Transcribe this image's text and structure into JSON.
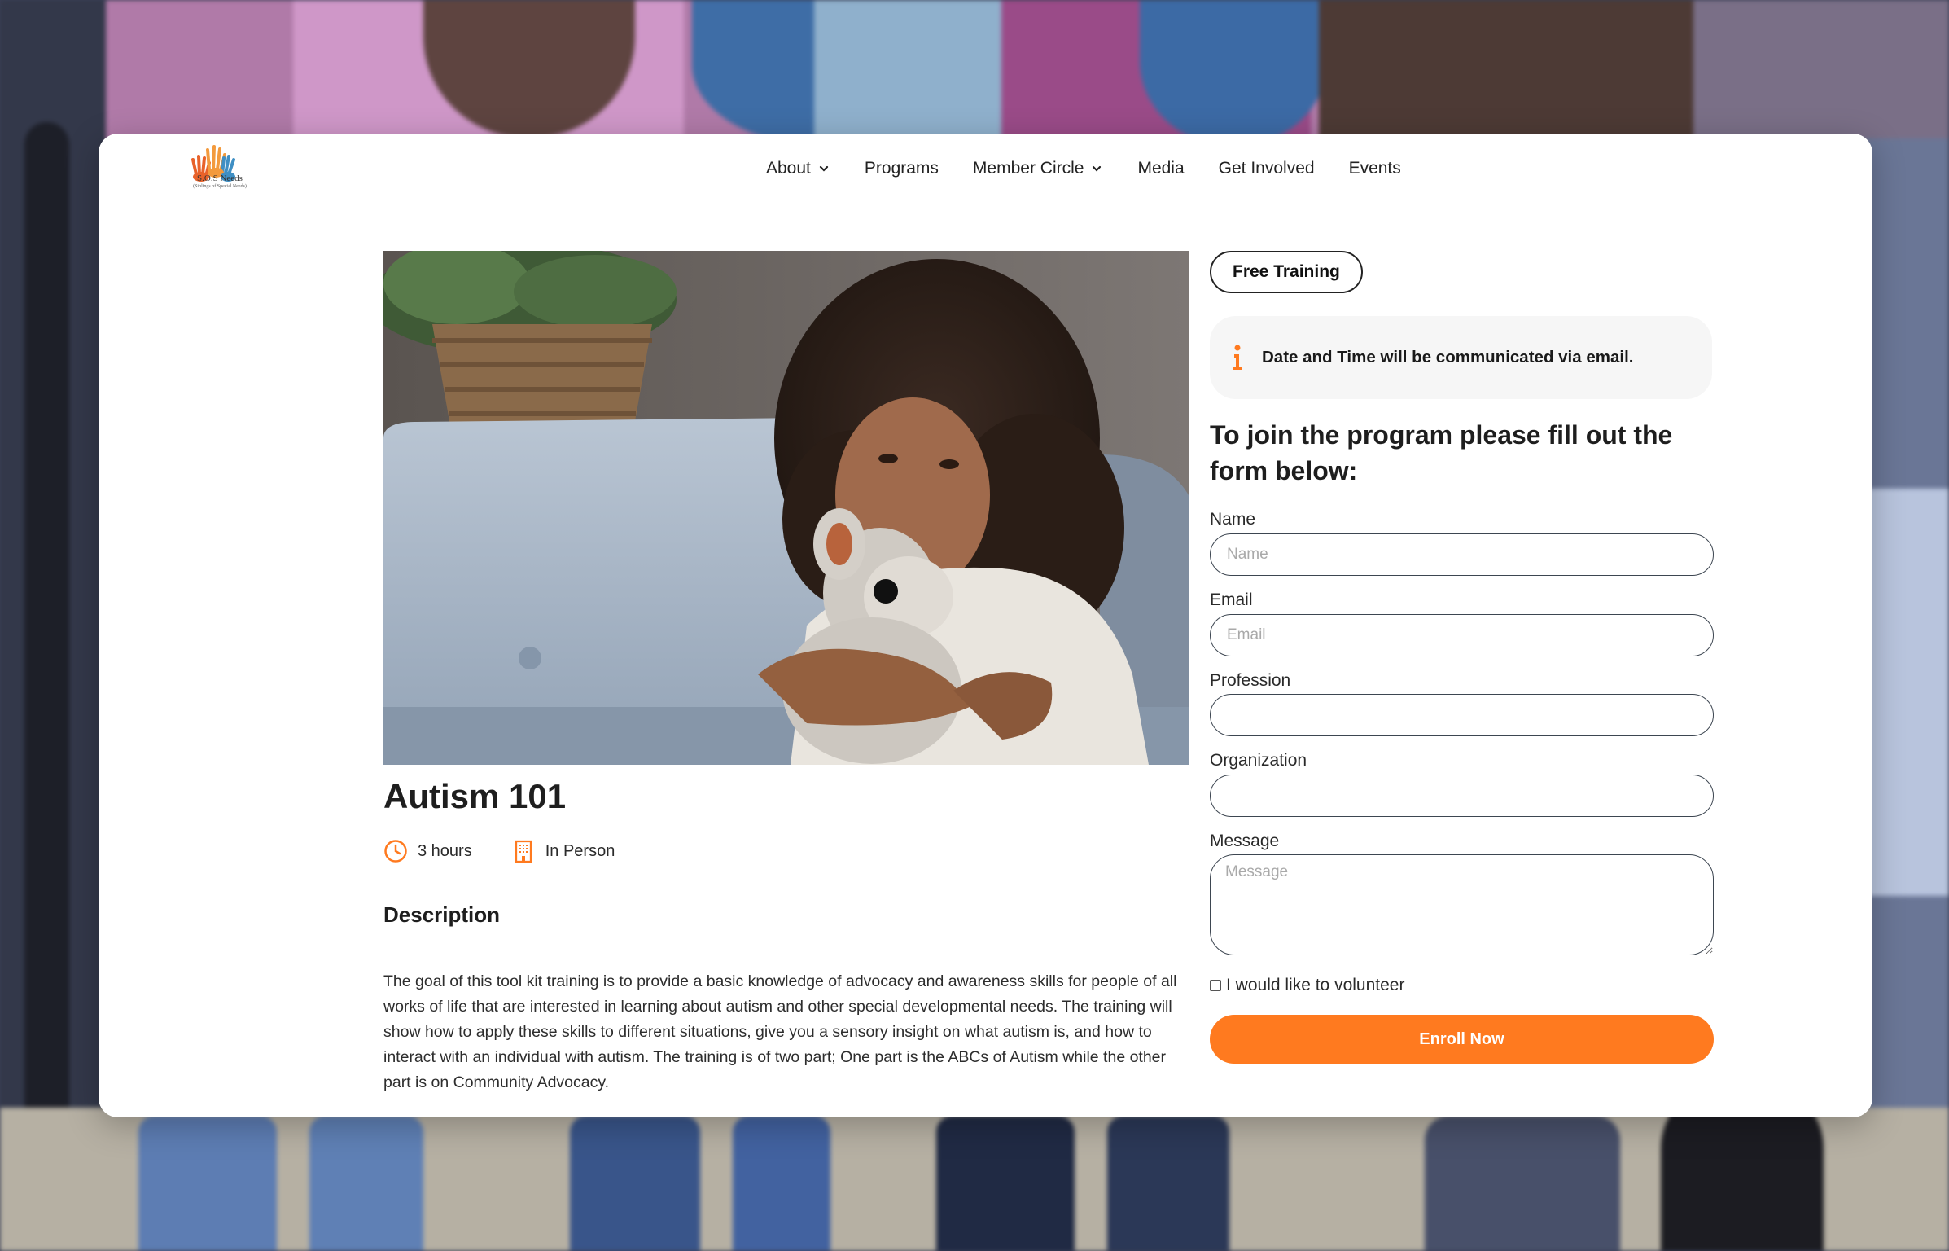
{
  "brand": {
    "name": "S.O.S Needs",
    "tagline": "(Siblings of Special Needs)",
    "accent_color": "#ff7a1f"
  },
  "nav": {
    "items": [
      {
        "label": "About",
        "has_dropdown": true
      },
      {
        "label": "Programs",
        "has_dropdown": false
      },
      {
        "label": "Member Circle",
        "has_dropdown": true
      },
      {
        "label": "Media",
        "has_dropdown": false
      },
      {
        "label": "Get Involved",
        "has_dropdown": false
      },
      {
        "label": "Events",
        "has_dropdown": false
      }
    ]
  },
  "program": {
    "image_icon": "hero-photo-girl-with-teddy-bear",
    "title": "Autism 101",
    "duration": "3 hours",
    "duration_icon": "clock-icon",
    "format": "In Person",
    "format_icon": "building-icon",
    "description_heading": "Description",
    "description": "The goal of this tool kit training is to provide a basic knowledge of advocacy and awareness skills for people of all works of life that are interested in learning about autism and other special developmental needs. The training will show how to apply these skills to different situations, give you a sensory insight on what autism is, and how to interact with an individual with autism. The training is of two part; One part is the ABCs of Autism while the other part is on Community Advocacy."
  },
  "sidebar": {
    "tag": "Free Training",
    "notice_icon": "info-icon",
    "notice": "Date and Time will be communicated via email.",
    "form_heading": "To join the program please fill out the form below:",
    "fields": {
      "name_label": "Name",
      "name_placeholder": "Name",
      "name_value": "",
      "email_label": "Email",
      "email_placeholder": "Email",
      "email_value": "",
      "profession_label": "Profession",
      "profession_value": "",
      "organization_label": "Organization",
      "organization_value": "",
      "message_label": "Message",
      "message_placeholder": "Message",
      "message_value": ""
    },
    "volunteer_label": "I would like to volunteer",
    "volunteer_checked": false,
    "submit_label": "Enroll Now"
  }
}
